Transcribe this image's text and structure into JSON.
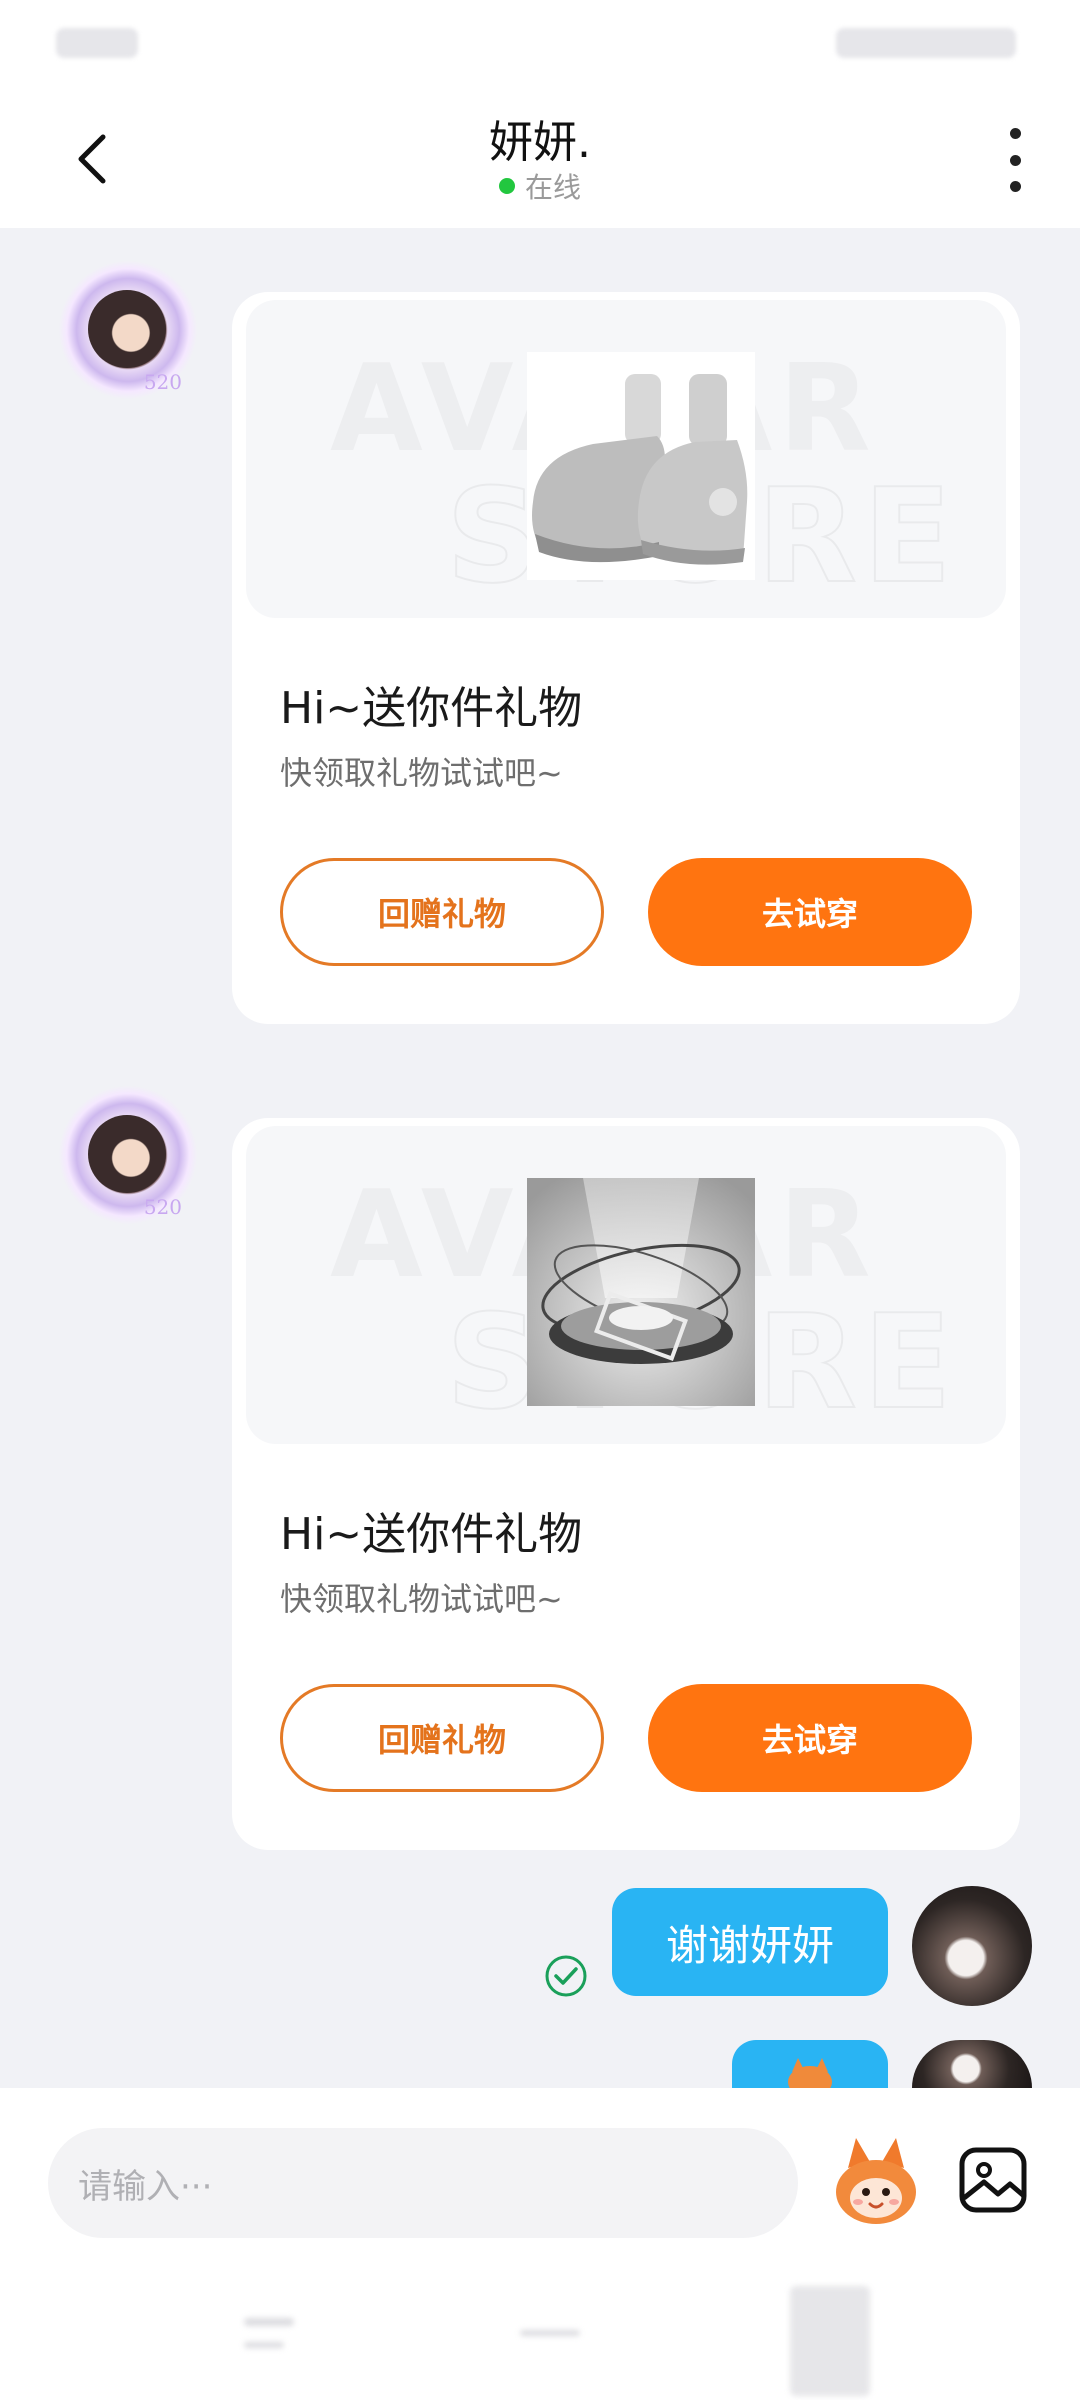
{
  "header": {
    "title": "妍妍.",
    "status": "在线",
    "back_label": "back",
    "more_label": "more"
  },
  "messages": [
    {
      "type": "gift",
      "heading": "Hi~送你件礼物",
      "subtext": "快领取礼物试试吧~",
      "return_label": "回赠礼物",
      "try_label": "去试穿",
      "badge": "520",
      "item": "sneakers"
    },
    {
      "type": "gift",
      "heading": "Hi~送你件礼物",
      "subtext": "快领取礼物试试吧~",
      "return_label": "回赠礼物",
      "try_label": "去试穿",
      "badge": "520",
      "item": "hologram-platform"
    },
    {
      "type": "text",
      "text": "谢谢妍妍",
      "status": "read"
    }
  ],
  "input": {
    "placeholder": "请输入···"
  },
  "colors": {
    "accent": "#ff7410",
    "bubble": "#29b4f3",
    "online": "#22c73f"
  }
}
